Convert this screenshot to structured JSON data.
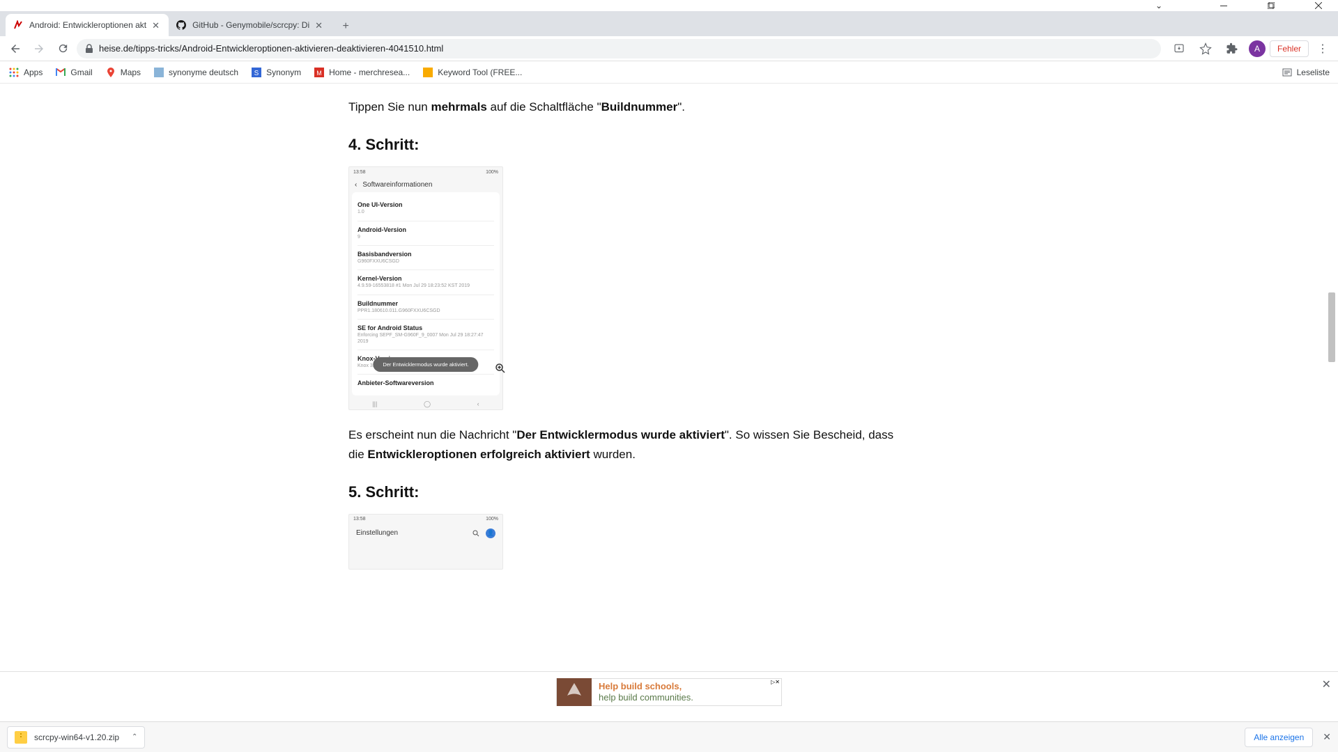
{
  "window": {
    "tabs": [
      {
        "title": "Android: Entwickleroptionen akt",
        "favicon": "heise"
      },
      {
        "title": "GitHub - Genymobile/scrcpy: Di",
        "favicon": "github"
      }
    ]
  },
  "toolbar": {
    "url": "heise.de/tipps-tricks/Android-Entwickleroptionen-aktivieren-deaktivieren-4041510.html",
    "avatar_initial": "A",
    "error_label": "Fehler"
  },
  "bookmarks": [
    {
      "icon": "apps",
      "label": "Apps"
    },
    {
      "icon": "gmail",
      "label": "Gmail"
    },
    {
      "icon": "maps",
      "label": "Maps"
    },
    {
      "icon": "syn",
      "label": "synonyme deutsch"
    },
    {
      "icon": "syn2",
      "label": "Synonym"
    },
    {
      "icon": "merch",
      "label": "Home - merchresea..."
    },
    {
      "icon": "kw",
      "label": "Keyword Tool (FREE..."
    }
  ],
  "bookmarks_right": {
    "label": "Leseliste"
  },
  "article": {
    "intro_pre": "Tippen Sie nun ",
    "intro_bold1": "mehrmals",
    "intro_mid": " auf die Schaltfläche \"",
    "intro_bold2": "Buildnummer",
    "intro_post": "\".",
    "step4": "4. Schritt:",
    "p2_pre": "Es erscheint nun die Nachricht \"",
    "p2_bold1": "Der Entwicklermodus wurde aktiviert",
    "p2_mid": "\". So wissen Sie Bescheid, dass die ",
    "p2_bold2": "Entwickleroptionen erfolgreich aktiviert",
    "p2_post": " wurden.",
    "step5": "5. Schritt:"
  },
  "phone1": {
    "time": "13:58",
    "status_right": "100%",
    "header": "Softwareinformationen",
    "rows": [
      {
        "title": "One UI-Version",
        "sub": "1.0"
      },
      {
        "title": "Android-Version",
        "sub": "9"
      },
      {
        "title": "Basisbandversion",
        "sub": "G960FXXU6CSGD"
      },
      {
        "title": "Kernel-Version",
        "sub": "4.9.59-16553818\n#1 Mon Jul 29 18:23:52 KST 2019"
      },
      {
        "title": "Buildnummer",
        "sub": "PPR1.180610.011.G960FXXU6CSGD"
      },
      {
        "title": "SE for Android Status",
        "sub": "Enforcing\nSEPF_SM-G960F_9_0007\nMon Jul 29 18:27:47 2019"
      },
      {
        "title": "Knox-Version",
        "sub": "Knox 3.3\nTIMA 4.0.0"
      },
      {
        "title": "Anbieter-Softwareversion",
        "sub": ""
      }
    ],
    "toast": "Der Entwicklermodus wurde aktiviert."
  },
  "phone2": {
    "time": "13:58",
    "status_right": "100%",
    "header": "Einstellungen"
  },
  "ad": {
    "line1": "Help build schools,",
    "line2": "help build communities.",
    "badge": "▷✕"
  },
  "downloads": {
    "file": "scrcpy-win64-v1.20.zip",
    "show_all": "Alle anzeigen"
  }
}
